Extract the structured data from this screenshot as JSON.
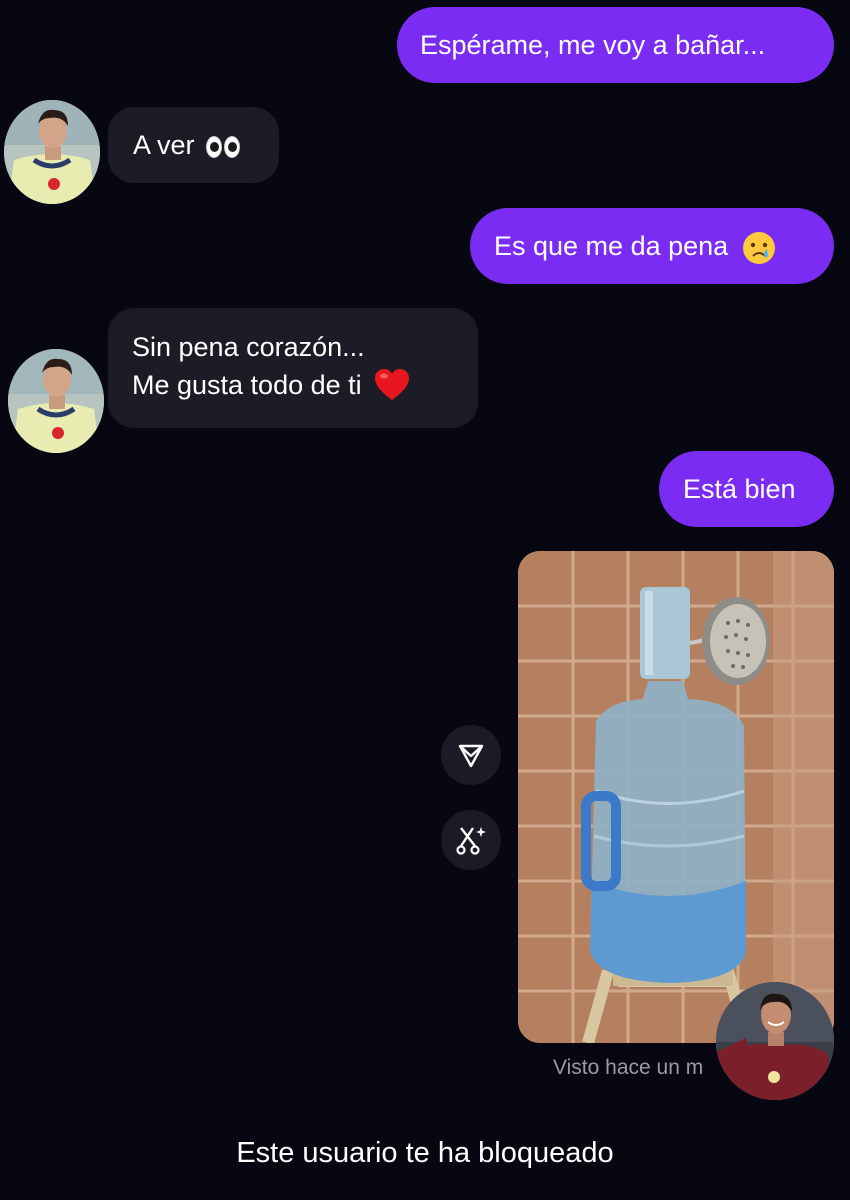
{
  "messages": [
    {
      "id": "m1",
      "from": "me",
      "text": "Espérame, me voy a bañar..."
    },
    {
      "id": "m2",
      "from": "contact",
      "text": "A ver",
      "emoji": "eyes-emoji"
    },
    {
      "id": "m3",
      "from": "me",
      "text": "Es que me da pena",
      "emoji": "crying-face-emoji"
    },
    {
      "id": "m4",
      "from": "contact",
      "lines": [
        "Sin pena corazón...",
        "Me gusta todo de ti"
      ],
      "emoji": "red-heart-emoji"
    },
    {
      "id": "m5",
      "from": "me",
      "text": "Está bien"
    },
    {
      "id": "m6",
      "from": "me",
      "type": "image",
      "image": "water-jug-shower-photo"
    }
  ],
  "actions": {
    "share_icon": "send-icon",
    "remix_icon": "scissors-sparkle-icon"
  },
  "status": {
    "seen": "Visto hace un m"
  },
  "footer": {
    "blocked": "Este usuario te ha bloqueado"
  },
  "colors": {
    "background": "#070711",
    "sent_bubble": "#7a2cf2",
    "received_bubble": "#1c1c27",
    "seen_text": "#9a9aa6"
  }
}
